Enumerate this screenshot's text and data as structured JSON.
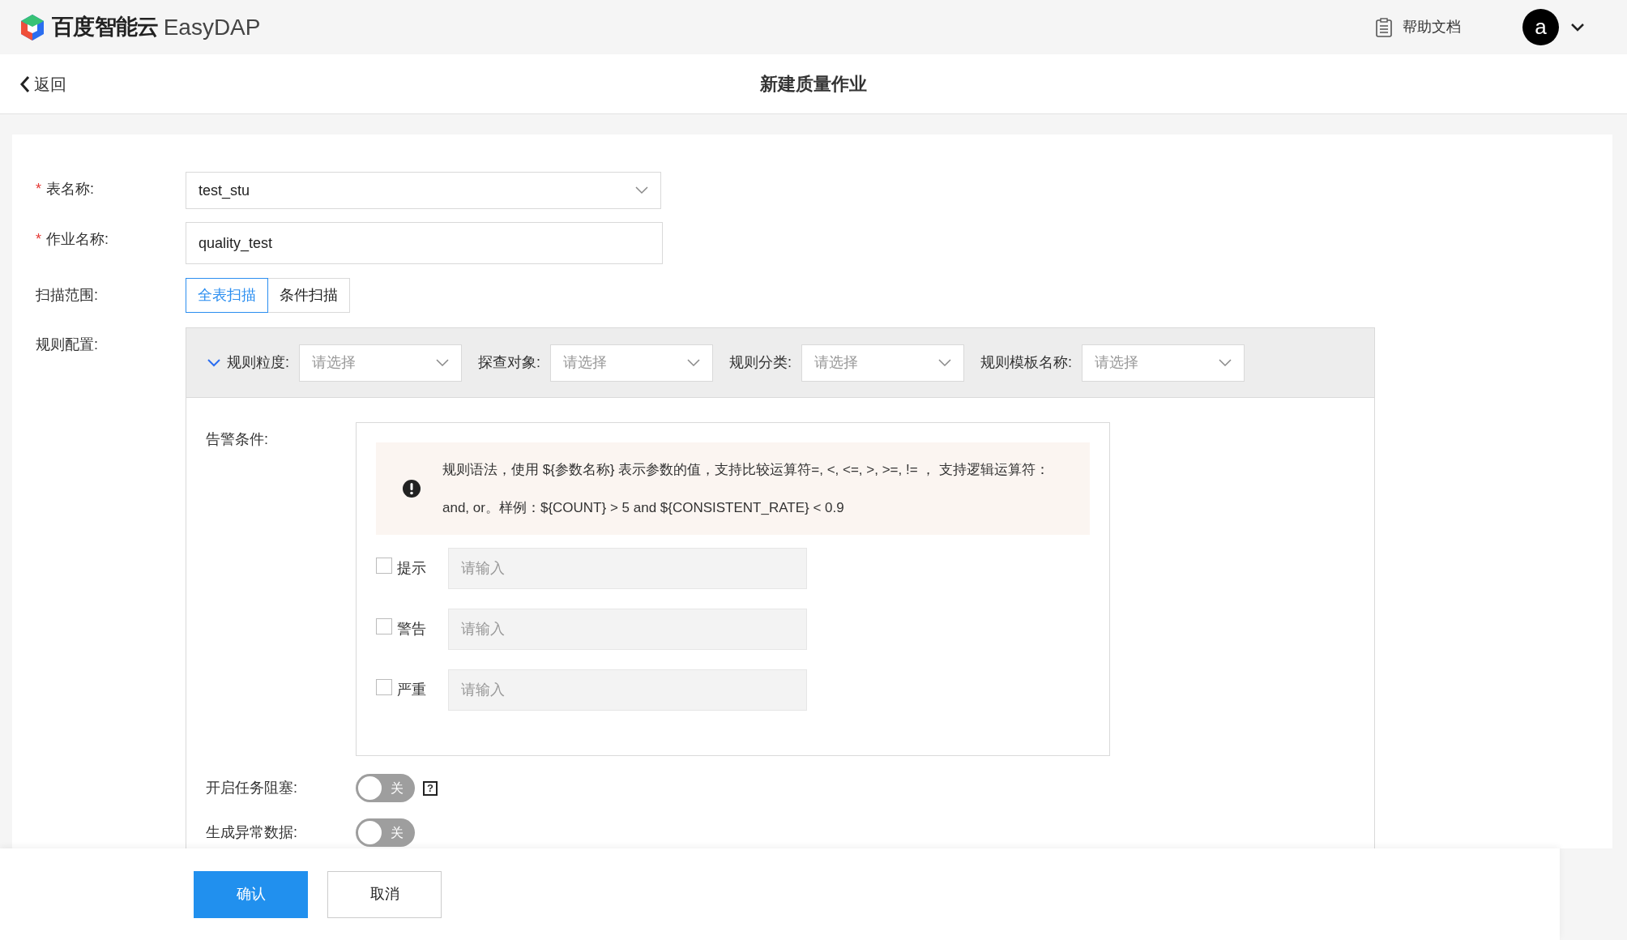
{
  "header": {
    "brand": "百度智能云",
    "product": "EasyDAP",
    "help": "帮助文档",
    "avatar": "a"
  },
  "subheader": {
    "back": "返回",
    "title": "新建质量作业"
  },
  "form": {
    "table_name": {
      "label": "表名称:",
      "required_mark": "*",
      "value": "test_stu"
    },
    "job_name": {
      "label": "作业名称:",
      "required_mark": "*",
      "value": "quality_test"
    },
    "scan_scope": {
      "label": "扫描范围:",
      "options": [
        {
          "label": "全表扫描",
          "selected": true
        },
        {
          "label": "条件扫描",
          "selected": false
        }
      ]
    },
    "rule_config": {
      "label": "规则配置:",
      "expanded": true,
      "filters": [
        {
          "label": "规则粒度:",
          "placeholder": "请选择"
        },
        {
          "label": "探查对象:",
          "placeholder": "请选择"
        },
        {
          "label": "规则分类:",
          "placeholder": "请选择"
        },
        {
          "label": "规则模板名称:",
          "placeholder": "请选择"
        }
      ],
      "alert": {
        "label": "告警条件:",
        "info": "规则语法，使用 ${参数名称} 表示参数的值，支持比较运算符=, <, <=, >, >=, != ， 支持逻辑运算符：and, or。样例：${COUNT} > 5 and ${CONSISTENT_RATE} < 0.9",
        "levels": [
          {
            "label": "提示",
            "checked": false,
            "placeholder": "请输入"
          },
          {
            "label": "警告",
            "checked": false,
            "placeholder": "请输入"
          },
          {
            "label": "严重",
            "checked": false,
            "placeholder": "请输入"
          }
        ]
      },
      "switches": [
        {
          "label": "开启任务阻塞:",
          "on": false,
          "text": "关",
          "help": "?"
        },
        {
          "label": "生成异常数据:",
          "on": false,
          "text": "关"
        }
      ]
    }
  },
  "footer": {
    "confirm": "确认",
    "cancel": "取消"
  }
}
